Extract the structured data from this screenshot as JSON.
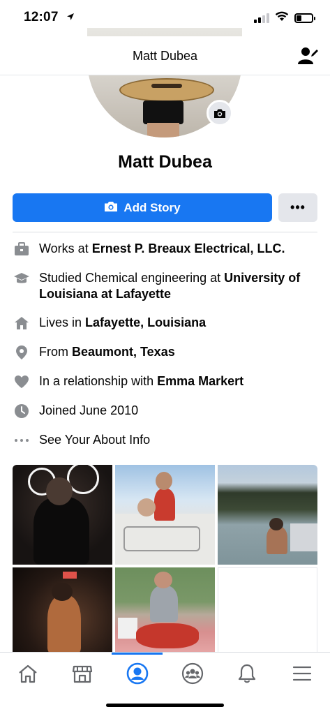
{
  "status_bar": {
    "time": "12:07",
    "battery_level": 0.35
  },
  "header": {
    "title": "Matt Dubea"
  },
  "profile": {
    "name": "Matt Dubea"
  },
  "actions": {
    "add_story_label": "Add Story",
    "more_label": "•••"
  },
  "intro": {
    "work": {
      "prefix": "Works at ",
      "bold": "Ernest P. Breaux Electrical, LLC."
    },
    "education": {
      "prefix": "Studied Chemical engineering at ",
      "bold": "University of Louisiana at Lafayette"
    },
    "lives": {
      "prefix": "Lives in ",
      "bold": "Lafayette, Louisiana"
    },
    "from": {
      "prefix": "From ",
      "bold": "Beaumont, Texas"
    },
    "relationship": {
      "prefix": "In a relationship with ",
      "bold": "Emma Markert"
    },
    "joined": {
      "text": "Joined June 2010"
    },
    "about": {
      "text": "See Your About Info"
    }
  },
  "tabs": [
    "home-icon",
    "marketplace-icon",
    "profile-icon",
    "groups-icon",
    "notifications-icon",
    "menu-icon"
  ],
  "colors": {
    "accent": "#1877f2",
    "icon_gray": "#65676b"
  }
}
